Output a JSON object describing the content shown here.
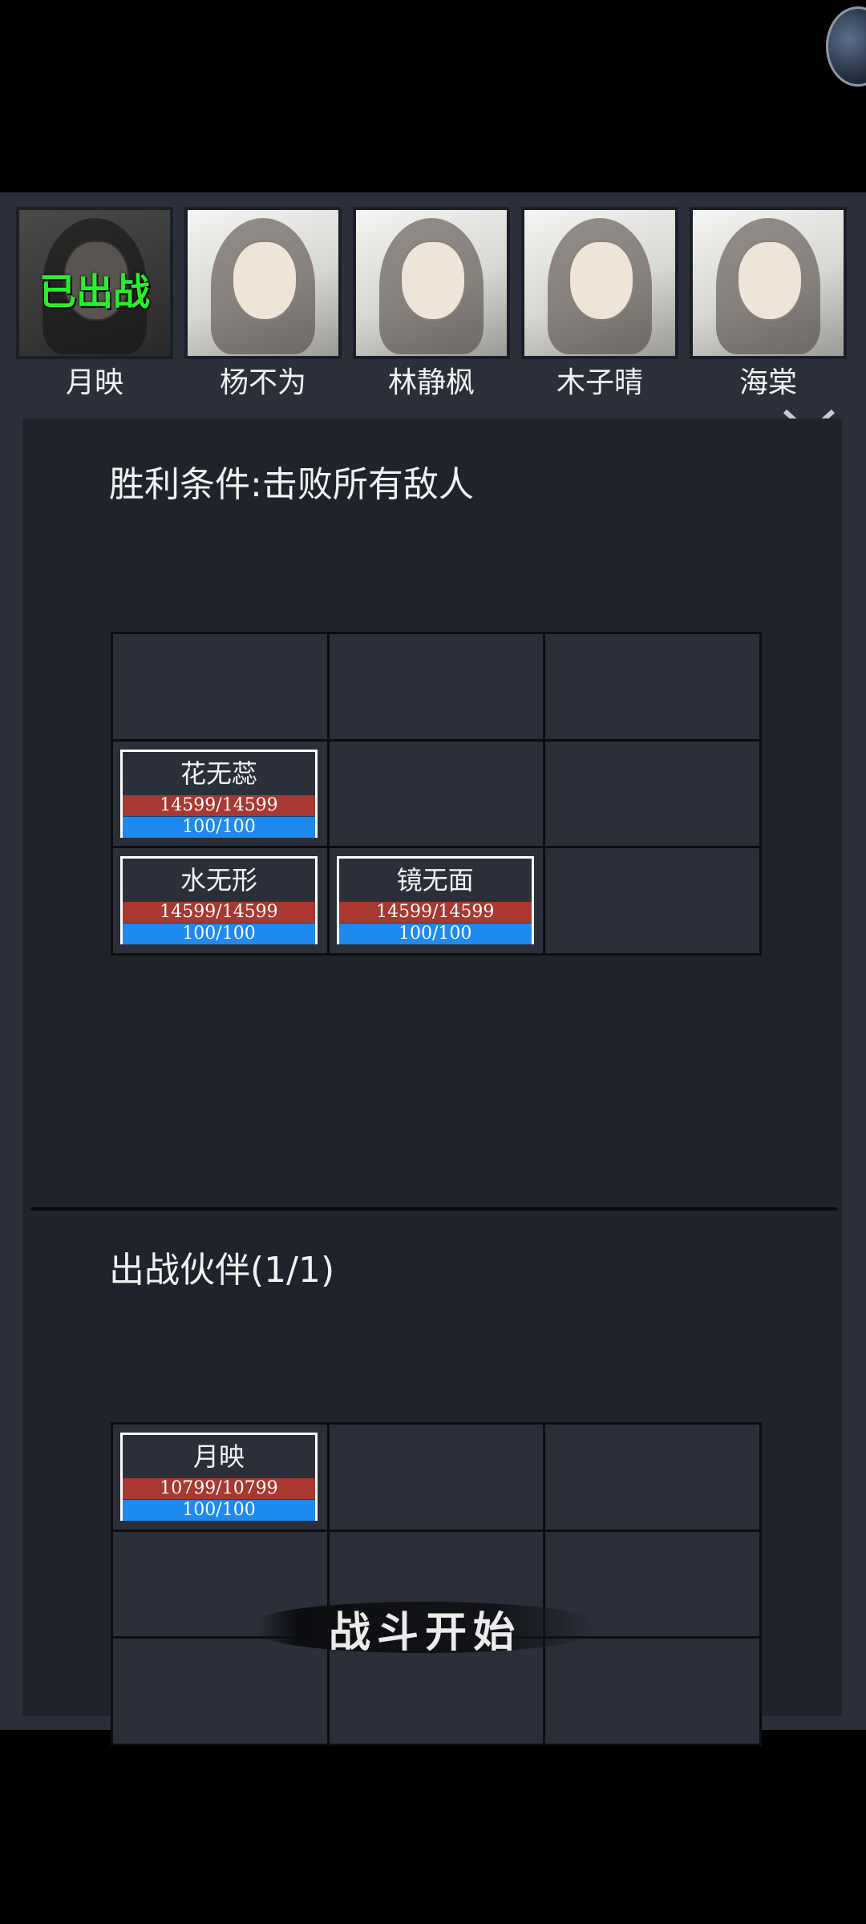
{
  "roster": [
    {
      "name": "月映",
      "status": "已出战"
    },
    {
      "name": "杨不为",
      "status": ""
    },
    {
      "name": "林静枫",
      "status": ""
    },
    {
      "name": "木子晴",
      "status": ""
    },
    {
      "name": "海棠",
      "status": ""
    }
  ],
  "victory": {
    "title": "胜利条件:击败所有敌人"
  },
  "enemies": [
    {
      "name": "花无蕊",
      "hp": "14599/14599",
      "mp": "100/100"
    },
    {
      "name": "水无形",
      "hp": "14599/14599",
      "mp": "100/100"
    },
    {
      "name": "镜无面",
      "hp": "14599/14599",
      "mp": "100/100"
    }
  ],
  "partners": {
    "title": "出战伙伴(1/1)",
    "units": [
      {
        "name": "月映",
        "hp": "10799/10799",
        "mp": "100/100"
      }
    ]
  },
  "actions": {
    "start_label": "战斗开始"
  },
  "colors": {
    "deployed_text": "#27f02a",
    "hp_bar": "#a93830",
    "mp_bar": "#1e8af0"
  }
}
